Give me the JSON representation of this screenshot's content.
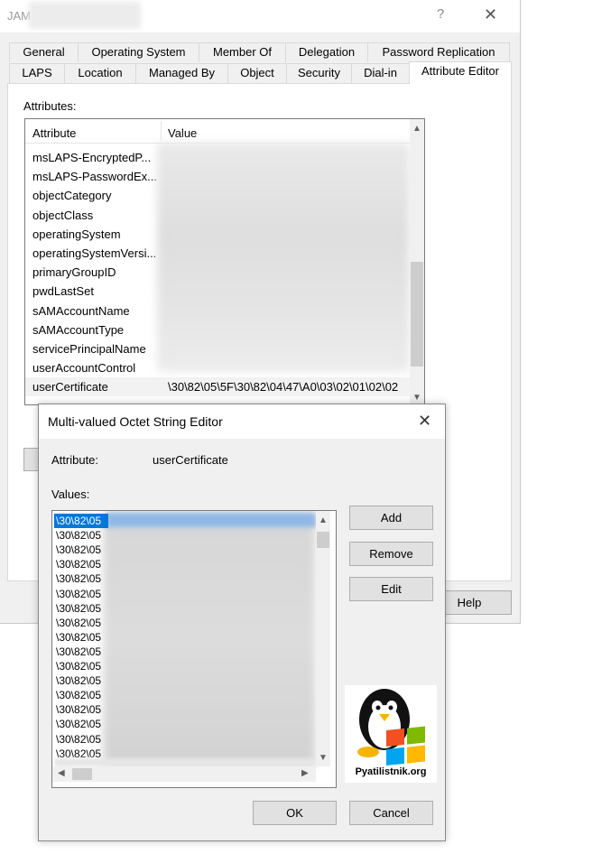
{
  "window": {
    "title": "JAM",
    "help_glyph": "?",
    "close_glyph": "✕"
  },
  "tabs": {
    "row1": [
      "General",
      "Operating System",
      "Member Of",
      "Delegation",
      "Password Replication"
    ],
    "row2": [
      "LAPS",
      "Location",
      "Managed By",
      "Object",
      "Security",
      "Dial-in",
      "Attribute Editor"
    ],
    "active": "Attribute Editor"
  },
  "attribute_editor": {
    "label": "Attributes:",
    "columns": [
      "Attribute",
      "Value"
    ],
    "rows": [
      {
        "name": "msLAPS-EncryptedP...",
        "value": ""
      },
      {
        "name": "msLAPS-PasswordEx...",
        "value": ""
      },
      {
        "name": "objectCategory",
        "value": ""
      },
      {
        "name": "objectClass",
        "value": ""
      },
      {
        "name": "operatingSystem",
        "value": ""
      },
      {
        "name": "operatingSystemVersi...",
        "value": ""
      },
      {
        "name": "primaryGroupID",
        "value": ""
      },
      {
        "name": "pwdLastSet",
        "value": ""
      },
      {
        "name": "sAMAccountName",
        "value": ""
      },
      {
        "name": "sAMAccountType",
        "value": ""
      },
      {
        "name": "servicePrincipalName",
        "value": ""
      },
      {
        "name": "userAccountControl",
        "value": ""
      },
      {
        "name": "userCertificate",
        "value": "\\30\\82\\05\\5F\\30\\82\\04\\47\\A0\\03\\02\\01\\02\\02"
      }
    ],
    "selected_row": "userCertificate",
    "help_button": "Help"
  },
  "dialog": {
    "title": "Multi-valued Octet String Editor",
    "close_glyph": "✕",
    "attribute_label": "Attribute:",
    "attribute_value": "userCertificate",
    "values_label": "Values:",
    "values": [
      "\\30\\82\\05",
      "\\30\\82\\05",
      "\\30\\82\\05",
      "\\30\\82\\05",
      "\\30\\82\\05",
      "\\30\\82\\05",
      "\\30\\82\\05",
      "\\30\\82\\05",
      "\\30\\82\\05",
      "\\30\\82\\05",
      "\\30\\82\\05",
      "\\30\\82\\05",
      "\\30\\82\\05",
      "\\30\\82\\05",
      "\\30\\82\\05",
      "\\30\\82\\05",
      "\\30\\82\\05"
    ],
    "buttons": {
      "add": "Add",
      "remove": "Remove",
      "edit": "Edit",
      "ok": "OK",
      "cancel": "Cancel"
    },
    "logo_text": "Pyatilistnik.org"
  },
  "colors": {
    "selection": "#0078d7",
    "window_bg": "#f0f0f0",
    "button_bg": "#e1e1e1"
  }
}
